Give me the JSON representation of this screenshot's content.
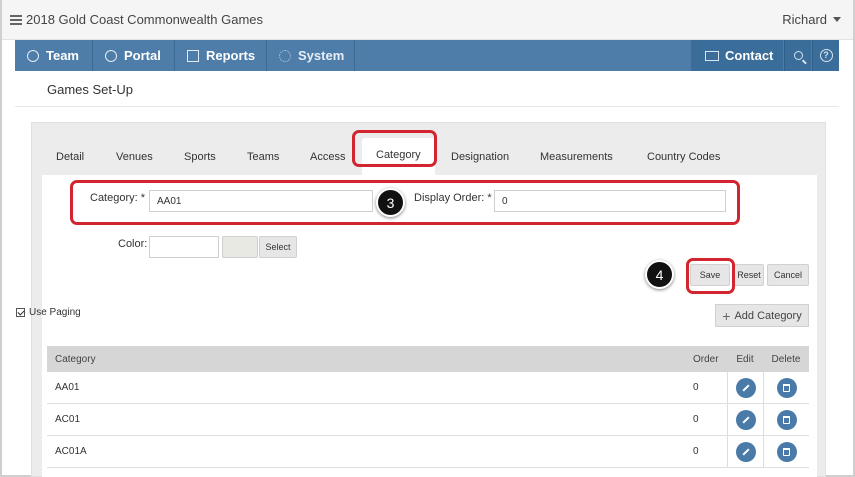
{
  "app": {
    "title": "2018 Gold Coast Commonwealth Games",
    "user": "Richard"
  },
  "nav": {
    "items": [
      {
        "label": "Team",
        "icon": "team-icon"
      },
      {
        "label": "Portal",
        "icon": "globe-icon"
      },
      {
        "label": "Reports",
        "icon": "reports-icon"
      },
      {
        "label": "System",
        "icon": "gear-icon"
      }
    ],
    "contact": "Contact"
  },
  "page": {
    "title": "Games Set-Up"
  },
  "tabs": [
    "Detail",
    "Venues",
    "Sports",
    "Teams",
    "Access",
    "Category",
    "Designation",
    "Measurements",
    "Country Codes"
  ],
  "active_tab": "Category",
  "form": {
    "category_label": "Category: *",
    "category_value": "AA01",
    "display_order_label": "Display Order: *",
    "display_order_value": "0",
    "color_label": "Color:",
    "color_value": "",
    "select_label": "Select",
    "save_label": "Save",
    "reset_label": "Reset",
    "cancel_label": "Cancel"
  },
  "callouts": {
    "step3": "3",
    "step4": "4"
  },
  "paging": {
    "label": "Use Paging",
    "checked": true
  },
  "add_category_label": "Add Category",
  "table": {
    "headers": {
      "category": "Category",
      "order": "Order",
      "edit": "Edit",
      "delete": "Delete"
    },
    "rows": [
      {
        "category": "AA01",
        "order": "0"
      },
      {
        "category": "AC01",
        "order": "0"
      },
      {
        "category": "AC01A",
        "order": "0"
      }
    ]
  },
  "colors": {
    "nav": "#4d7da8",
    "nav_dark": "#3a6d9a",
    "highlight": "#d3252f",
    "action_button": "#4a7aa7"
  }
}
